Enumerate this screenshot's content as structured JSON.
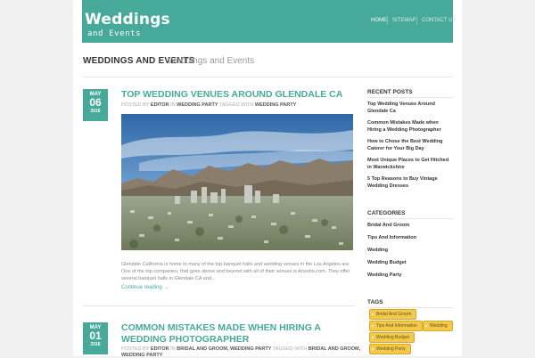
{
  "site": {
    "logo_line1": "Weddings",
    "logo_line2": "and Events",
    "title": "WEDDINGS AND EVENTS",
    "tagline": "Weddings and Events"
  },
  "nav": {
    "home": "HOME",
    "sitemap": "SITEMAP",
    "contact": "CONTACT US"
  },
  "posts": [
    {
      "month": "MAY",
      "day": "06",
      "year": "2016",
      "title": "TOP WEDDING VENUES AROUND GLENDALE CA",
      "meta_posted_by": "POSTED BY",
      "author": "EDITOR",
      "meta_in": "IN",
      "category": "WEDDING PARTY",
      "meta_tagged": "TAGGED WITH",
      "tags": "WEDDING PARTY",
      "excerpt": "Glendale California is home to many of the top banquet halls and wedding venues in the Los Angeles are. One of the top companies, that goes above and beyond with all of their venues is Anoohs.com. They offer several banquet halls in Glendale CA and...",
      "more": "Continue reading →"
    },
    {
      "month": "MAY",
      "day": "01",
      "year": "2016",
      "title": "COMMON MISTAKES MADE WHEN HIRING A WEDDING PHOTOGRAPHER",
      "meta_posted_by": "POSTED BY",
      "author": "EDITOR",
      "meta_in": "IN",
      "category": "BRIDAL AND GROOM, WEDDING PARTY",
      "meta_tagged": "TAGGED WITH",
      "tags": "BRIDAL AND GROOM,",
      "tags_line2": "WEDDING PARTY"
    }
  ],
  "sidebar": {
    "recent_heading": "RECENT POSTS",
    "recent": [
      "Top Wedding Venues Around Glendale Ca",
      "Common Mistakes Made when Hiring a Wedding Photographer",
      "How to Chose the Best Wedding Caterer for Your Big Day",
      "Most Unique Places to Get Hitched in Warwickshire",
      "5 Top Reasons to Buy Vintage Wedding Dresses"
    ],
    "categories_heading": "CATEGORIES",
    "categories": [
      "Bridal And Groom",
      "Tips And Information",
      "Wedding",
      "Wedding Budget",
      "Wedding Party"
    ],
    "tags_heading": "TAGS",
    "tags": [
      "Bridal And Groom",
      "Tips And Information",
      "Wedding",
      "Wedding Budget",
      "Wedding Party"
    ]
  },
  "colors": {
    "accent": "#46a99a",
    "tag": "#f2c94c"
  }
}
